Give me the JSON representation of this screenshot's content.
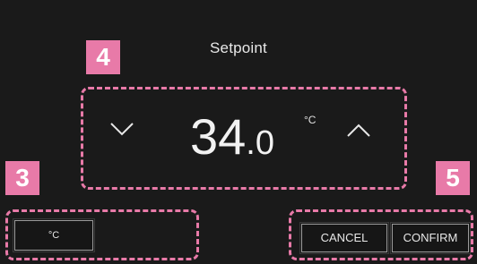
{
  "screen": {
    "title": "Setpoint"
  },
  "badges": {
    "setpoint_callout": "4",
    "unit_callout": "3",
    "actions_callout": "5"
  },
  "setpoint": {
    "integer": "34",
    "decimal": ".0",
    "unit": "°C",
    "decrease_icon": "chevron-down-icon",
    "increase_icon": "chevron-up-icon"
  },
  "unit_selector": {
    "label": "°C"
  },
  "actions": {
    "cancel_label": "CANCEL",
    "confirm_label": "CONFIRM"
  },
  "colors": {
    "screen_background": "#1a1a1a",
    "callout_accent": "#e87aa8",
    "text": "#f2f2f2"
  }
}
